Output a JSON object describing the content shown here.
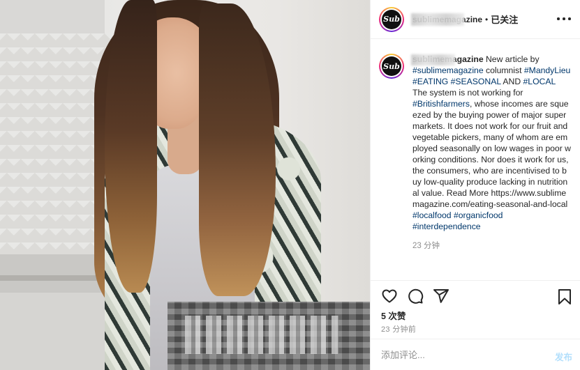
{
  "post": {
    "username": "sublimemagazine",
    "follow_dot": "•",
    "follow_label": "已关注",
    "avatar_text": "Sub",
    "caption": {
      "intro": "New article by",
      "tag_author_handle": "#sublimemagazine",
      "columnist": "columnist",
      "tag_mandy": "#MandyLieu",
      "tag_eating": "#EATING",
      "tag_seasonal": "#SEASONAL",
      "and": "AND",
      "tag_local": "#LOCAL",
      "text1": "The system is not working for",
      "tag_farmers": "#Britishfarmers",
      "text2": ", whose incomes are squeezed by the buying power of major supermarkets. It does not work for our fruit and vegetable pickers, many of whom are employed seasonally on low wages in poor working conditions. Nor does it work for us, the consumers, who are incentivised to buy low-quality produce lacking in nutritional value. Read More https://www.sublimemagazine.com/eating-seasonal-and-local",
      "tag_localfood": "#localfood",
      "tag_organicfood": "#organicfood",
      "tag_interdependence": "#interdependence"
    },
    "caption_time": "23 分钟",
    "likes": "5 次赞",
    "post_time": "23 分钟前",
    "comment_placeholder": "添加评论...",
    "post_button": "发布"
  },
  "icons": {
    "like": "heart-icon",
    "comment": "comment-icon",
    "share": "share-icon",
    "save": "bookmark-icon",
    "more": "more-icon"
  },
  "colors": {
    "hashtag": "#00376b",
    "muted": "#8e8e8e",
    "post_button_disabled": "#b2dffc"
  }
}
